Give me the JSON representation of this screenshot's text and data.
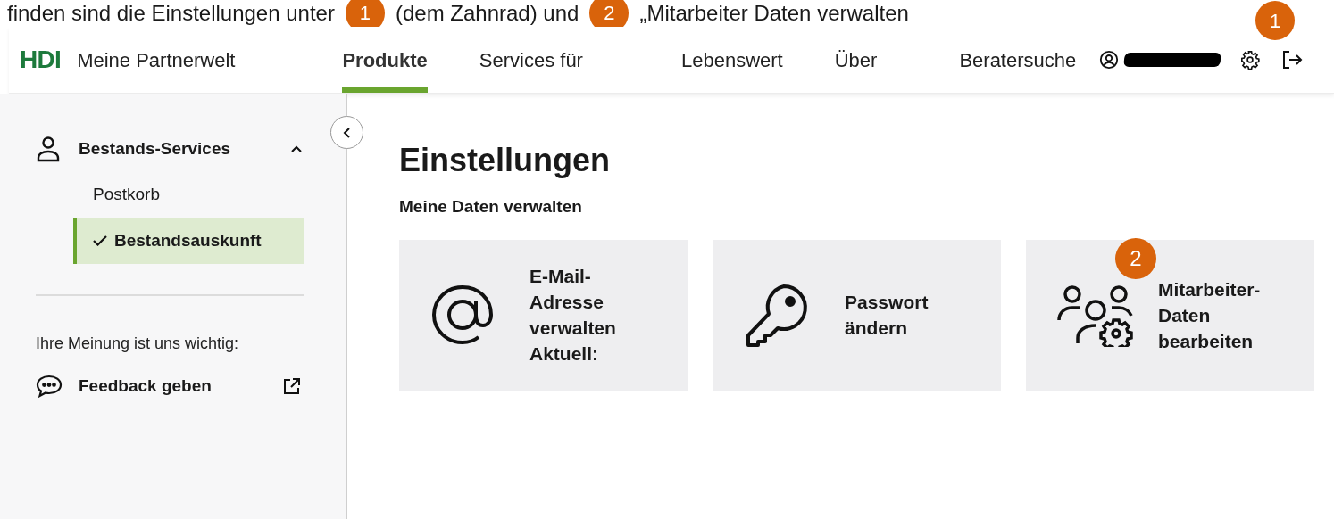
{
  "caption": [
    {
      "kind": "text",
      "text": "finden sind die Einstellungen unter"
    },
    {
      "kind": "badge",
      "text": "1"
    },
    {
      "kind": "text",
      "text": "(dem Zahnrad) und"
    },
    {
      "kind": "badge",
      "text": "2"
    },
    {
      "kind": "text",
      "text": "„Mitarbeiter Daten verwalten"
    }
  ],
  "header": {
    "logo": "HDI",
    "title": "Meine Partnerwelt",
    "nav": [
      {
        "label": "Produkte",
        "selected": true
      },
      {
        "label": "Services für",
        "selected": false
      },
      {
        "label": "Lebenswert",
        "selected": false
      },
      {
        "label": "Über",
        "selected": false
      },
      {
        "label": "Beratersuche",
        "selected": false
      }
    ],
    "settings_callout": "1"
  },
  "sidebar": {
    "section": {
      "label": "Bestands-Services",
      "expanded": true,
      "items": [
        {
          "label": "Postkorb",
          "selected": false
        },
        {
          "label": "Bestandsauskunft",
          "selected": true
        }
      ]
    },
    "feedback_prompt": "Ihre Meinung ist uns wichtig:",
    "feedback_link": "Feedback geben"
  },
  "main": {
    "title": "Einstellungen",
    "subtitle": "Meine Daten verwalten",
    "cards": [
      {
        "kind": "email",
        "lines": [
          "E-Mail-",
          "Adresse",
          "verwalten",
          "Aktuell:"
        ]
      },
      {
        "kind": "password",
        "lines": [
          "Passwort",
          "ändern"
        ]
      },
      {
        "kind": "staff",
        "lines": [
          "Mitarbeiter-",
          "Daten",
          "bearbeiten"
        ],
        "callout": "2"
      }
    ]
  }
}
